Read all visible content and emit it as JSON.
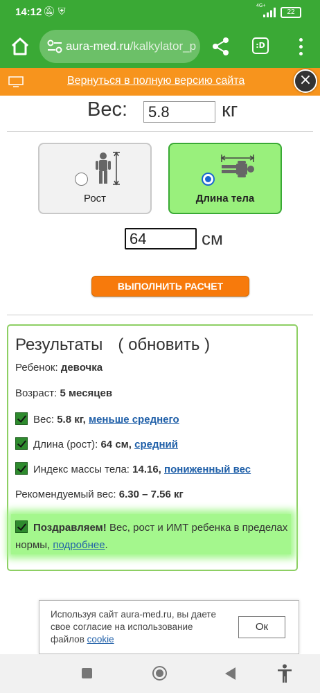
{
  "status_bar": {
    "time": "14:12",
    "battery": "22",
    "network": "4G+"
  },
  "browser": {
    "url_domain": "aura-med.ru",
    "url_path": "/kalkylator_pc",
    "tabs_label": ":D"
  },
  "banner": {
    "link_text": "Вернуться в полную версию сайта",
    "close_symbol": "×"
  },
  "form": {
    "weight_label": "Вес:",
    "weight_value": "5.8",
    "weight_unit": "кг",
    "mode_height_label": "Рост",
    "mode_length_label": "Длина тела",
    "length_value": "64",
    "length_unit": "см",
    "calc_button": "ВЫПОЛНИТЬ РАСЧЕТ"
  },
  "results": {
    "title": "Результаты",
    "refresh": "( обновить )",
    "child_label": "Ребенок: ",
    "child_value": "девочка",
    "age_label": "Возраст: ",
    "age_value": "5 месяцев",
    "weight_label": "Вес: ",
    "weight_value": "5.8 кг,",
    "weight_link": "меньше среднего",
    "length_label": "Длина (рост): ",
    "length_value": "64 см,",
    "length_link": "средний",
    "bmi_label": "Индекс массы тела: ",
    "bmi_value": "14.16,",
    "bmi_link": "пониженный вес",
    "recommended_label": "Рекомендуемый вес: ",
    "recommended_value": "6.30 – 7.56 кг",
    "congrats_bold": "Поздравляем!",
    "congrats_text": " Вес, рост и ИМТ ребенка в пределах нормы, ",
    "congrats_link": "подробнее",
    "congrats_end": "."
  },
  "cookie": {
    "message": "Используя сайт aura-med.ru, вы даете свое согласие на использование файлов ",
    "link": "cookie",
    "ok_button": "Ок"
  },
  "colors": {
    "brand_green": "#3aa935",
    "banner_orange": "#f7941d",
    "button_orange": "#f77a0c",
    "selected_card": "#99f07c",
    "highlight_green": "#a4f78d",
    "link_blue": "#1f5fa8"
  },
  "icons": [
    "home-icon",
    "tune-icon",
    "share-icon",
    "tabs-icon",
    "menu-icon",
    "monitor-icon",
    "close-icon",
    "standing-child-icon",
    "lying-child-icon",
    "checkbox-icon",
    "accessibility-icon"
  ]
}
